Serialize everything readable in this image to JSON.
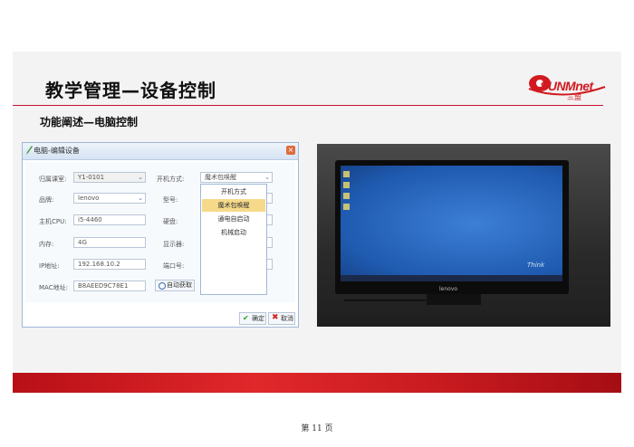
{
  "slide": {
    "title": "教学管理—设备控制",
    "subtitle": "功能阐述—电脑控制",
    "logo": {
      "name": "SUNMnet",
      "sub": "三盟"
    },
    "page": "第 11 页",
    "brand_color": "#c8102e"
  },
  "dialog": {
    "title": "电脑-编辑设备",
    "fields": [
      {
        "label": "归属课室:",
        "value": "Y1-0101",
        "type": "select"
      },
      {
        "label": "品牌:",
        "value": "lenovo",
        "type": "select"
      },
      {
        "label": "主机CPU:",
        "value": "i5-4460",
        "type": "text"
      },
      {
        "label": "内存:",
        "value": "4G",
        "type": "text"
      },
      {
        "label": "IP地址:",
        "value": "192.168.10.2",
        "type": "text"
      },
      {
        "label": "MAC地址:",
        "value": "B8AEED9C78E1",
        "type": "text"
      }
    ],
    "right_fields": [
      {
        "label": "开机方式:",
        "value": "魔术包唤醒",
        "type": "select"
      },
      {
        "label": "型号:"
      },
      {
        "label": "硬盘:"
      },
      {
        "label": "显示器:"
      },
      {
        "label": "端口号:"
      }
    ],
    "auto_get_button": "自动获取",
    "boot_options": [
      "开机方式",
      "魔术包唤醒",
      "通电自启动",
      "机械启动"
    ],
    "ok_button": "确定",
    "cancel_button": "取消"
  },
  "photo": {
    "monitor_brand": "lenovo",
    "screen_text": "Think"
  }
}
